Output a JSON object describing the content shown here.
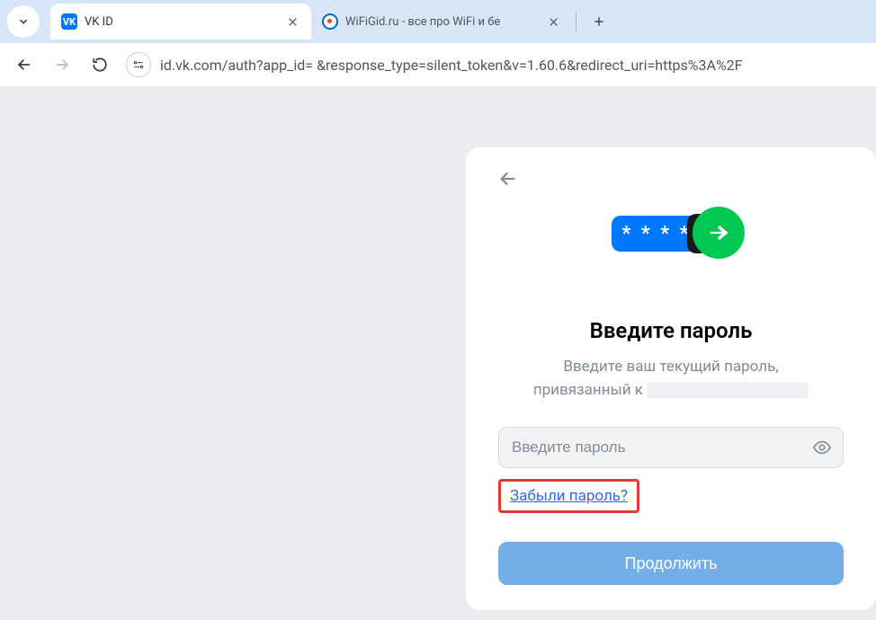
{
  "browser": {
    "tabs": [
      {
        "title": "VK ID",
        "favicon": "vk",
        "active": true
      },
      {
        "title": "WiFiGid.ru - все про WiFi и бе",
        "favicon": "wifi",
        "active": false
      }
    ],
    "url": "id.vk.com/auth?app_id=            &response_type=silent_token&v=1.60.6&redirect_uri=https%3A%2F"
  },
  "card": {
    "pill_text": "* * * *",
    "heading": "Введите пароль",
    "subheading_line1": "Введите ваш текущий пароль,",
    "subheading_line2_prefix": "привязанный к",
    "password_placeholder": "Введите пароль",
    "forgot_label": "Забыли пароль?",
    "continue_label": "Продолжить"
  }
}
